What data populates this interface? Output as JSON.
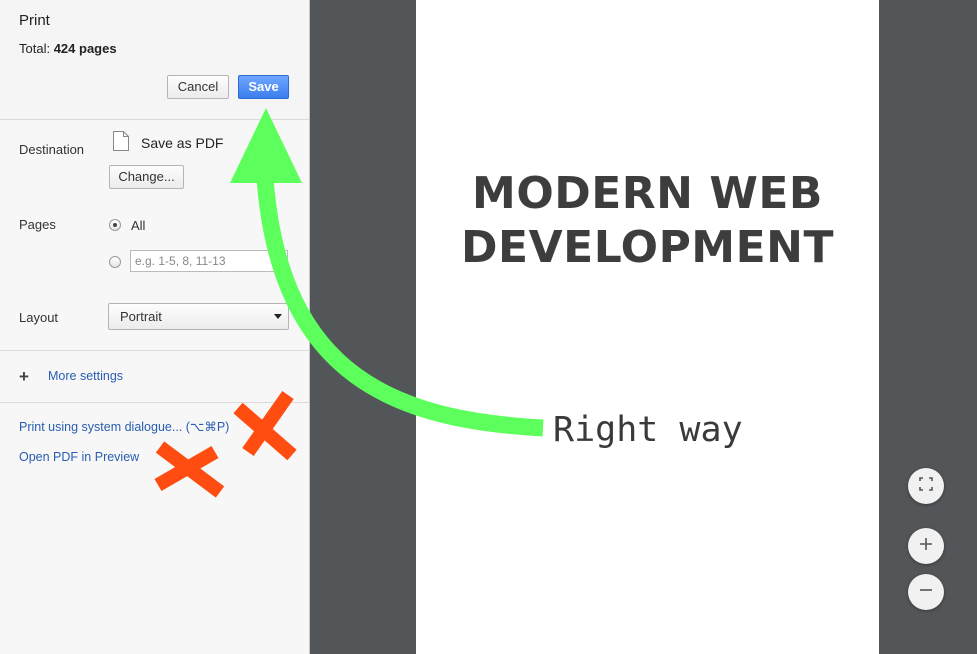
{
  "header": {
    "title": "Print",
    "total_label": "Total:",
    "total_value": "424 pages",
    "cancel_label": "Cancel",
    "save_label": "Save"
  },
  "destination": {
    "label": "Destination",
    "name": "Save as PDF",
    "change_label": "Change..."
  },
  "pages": {
    "label": "Pages",
    "all_label": "All",
    "selected": "All",
    "range_placeholder": "e.g. 1-5, 8, 11-13",
    "range_value": ""
  },
  "layout": {
    "label": "Layout",
    "selected": "Portrait"
  },
  "more_settings_label": "More settings",
  "links": {
    "system_dialogue": "Print using system dialogue... (⌥⌘P)",
    "open_pdf": "Open PDF in Preview"
  },
  "preview": {
    "title_line1": "MODERN WEB",
    "title_line2": "DEVELOPMENT"
  },
  "annotation": {
    "text": "Right way",
    "arrow_color": "#5cff5c",
    "cross_color": "#ff4d12"
  },
  "colors": {
    "accent": "#3b7eee",
    "link": "#2a5db0",
    "preview_bg": "#525659"
  },
  "icons": {
    "file": "file-icon",
    "plus": "plus-icon",
    "fit": "fit-to-page-icon",
    "zoom_in": "zoom-in-icon",
    "zoom_out": "zoom-out-icon"
  }
}
